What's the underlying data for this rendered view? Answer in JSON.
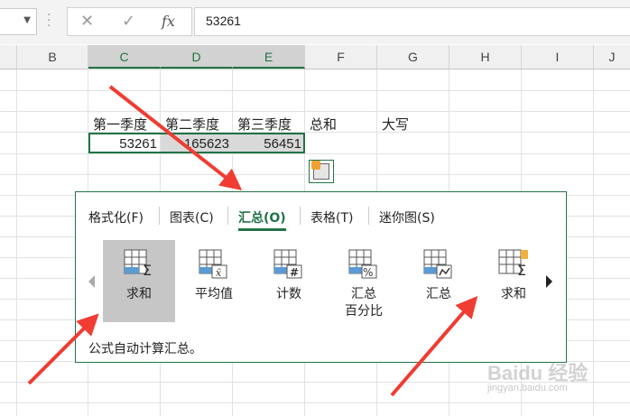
{
  "formula_bar": {
    "cancel_glyph": "✕",
    "enter_glyph": "✓",
    "fx_label": "fx",
    "value": "53261"
  },
  "columns": [
    "B",
    "C",
    "D",
    "E",
    "F",
    "G",
    "H",
    "I",
    "J"
  ],
  "selected_columns": [
    "C",
    "D",
    "E"
  ],
  "cells": {
    "header_row": [
      "第一季度",
      "第二季度",
      "第三季度",
      "总和",
      "大写"
    ],
    "data_row": [
      "53261",
      "165623",
      "56451"
    ]
  },
  "quick_analysis": {
    "tabs": [
      {
        "label": "格式化(F)",
        "active": false
      },
      {
        "label": "图表(C)",
        "active": false
      },
      {
        "label": "汇总(O)",
        "active": true
      },
      {
        "label": "表格(T)",
        "active": false
      },
      {
        "label": "迷你图(S)",
        "active": false
      }
    ],
    "items": [
      {
        "label": "求和",
        "icon": "sum-column-icon",
        "highlighted": true
      },
      {
        "label": "平均值",
        "icon": "average-column-icon",
        "highlighted": false
      },
      {
        "label": "计数",
        "icon": "count-column-icon",
        "highlighted": false
      },
      {
        "label": "汇总\n百分比",
        "icon": "percent-total-icon",
        "highlighted": false
      },
      {
        "label": "汇总",
        "icon": "running-total-icon",
        "highlighted": false
      },
      {
        "label": "求和",
        "icon": "sum-row-icon",
        "highlighted": false
      }
    ],
    "description": "公式自动计算汇总。"
  },
  "watermark": {
    "text": "Baidu 经验",
    "sub": "jingyan.baidu.com"
  },
  "colors": {
    "accent": "#217346",
    "annotation_arrow": "#f03c32"
  }
}
